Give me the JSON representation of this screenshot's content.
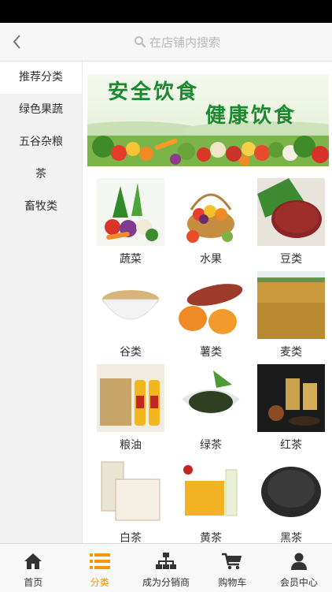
{
  "search": {
    "placeholder": "在店铺内搜索"
  },
  "sidebar": {
    "items": [
      {
        "label": "推荐分类"
      },
      {
        "label": "绿色果蔬"
      },
      {
        "label": "五谷杂粮"
      },
      {
        "label": "茶"
      },
      {
        "label": "畜牧类"
      }
    ]
  },
  "banner": {
    "text1": "安全饮食",
    "text2": "健康饮食"
  },
  "categories": [
    {
      "label": "蔬菜"
    },
    {
      "label": "水果"
    },
    {
      "label": "豆类"
    },
    {
      "label": "谷类"
    },
    {
      "label": "薯类"
    },
    {
      "label": "麦类"
    },
    {
      "label": "粮油"
    },
    {
      "label": "绿茶"
    },
    {
      "label": "红茶"
    },
    {
      "label": "白茶"
    },
    {
      "label": "黄茶"
    },
    {
      "label": "黑茶"
    }
  ],
  "nav": {
    "items": [
      {
        "label": "首页",
        "icon": "home-icon"
      },
      {
        "label": "分类",
        "icon": "list-icon"
      },
      {
        "label": "成为分销商",
        "icon": "org-chart-icon"
      },
      {
        "label": "购物车",
        "icon": "cart-icon"
      },
      {
        "label": "会员中心",
        "icon": "user-icon"
      }
    ]
  },
  "colors": {
    "accent": "#f39800",
    "banner_text": "#1a8a2e",
    "sidebar_bg": "#f2f2f2"
  }
}
